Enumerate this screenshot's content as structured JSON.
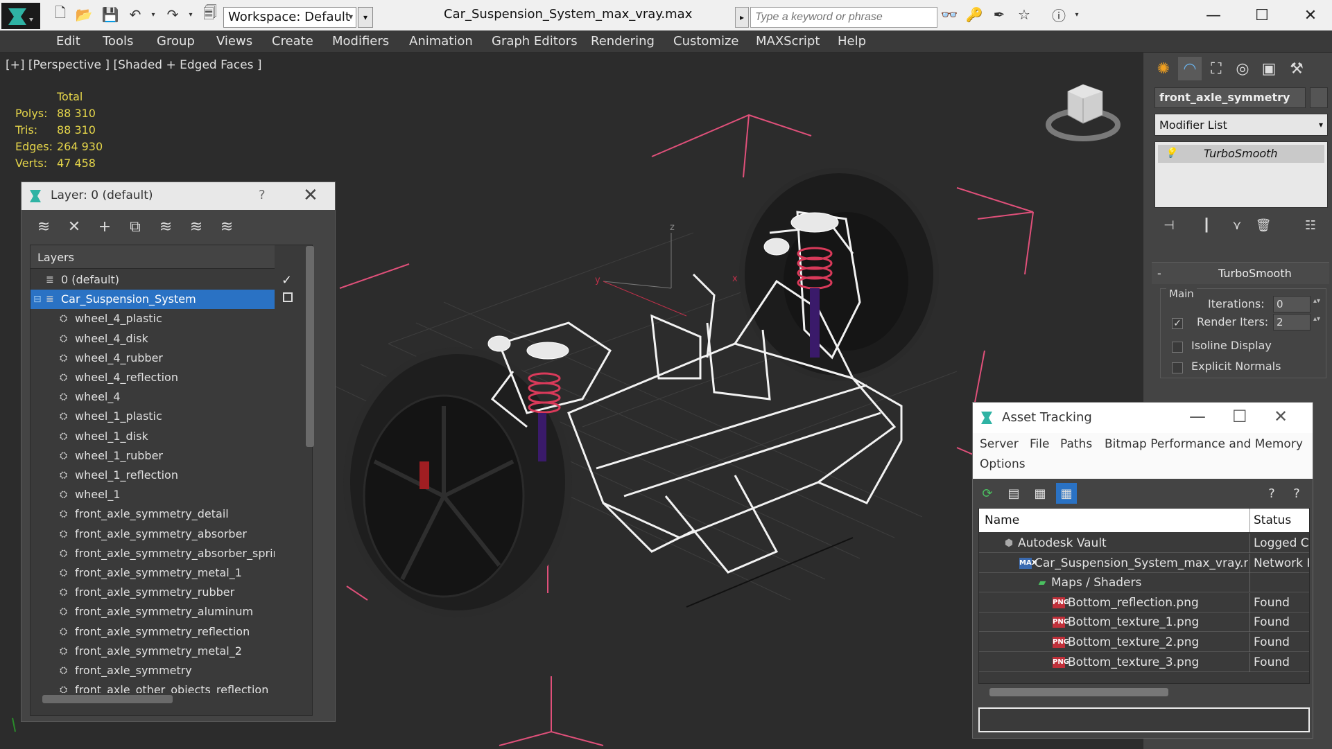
{
  "titlebar": {
    "workspace_value": "Workspace: Default",
    "document_title": "Car_Suspension_System_max_vray.max",
    "search_placeholder": "Type a keyword or phrase"
  },
  "menubar": {
    "items": [
      "Edit",
      "Tools",
      "Group",
      "Views",
      "Create",
      "Modifiers",
      "Animation",
      "Graph Editors",
      "Rendering",
      "Customize",
      "MAXScript",
      "Help"
    ]
  },
  "viewport": {
    "label": "[+] [Perspective ] [Shaded + Edged Faces ]",
    "stats": {
      "header": "Total",
      "rows": [
        {
          "key": "Polys:",
          "value": "88 310"
        },
        {
          "key": "Tris:",
          "value": "88 310"
        },
        {
          "key": "Edges:",
          "value": "264 930"
        },
        {
          "key": "Verts:",
          "value": "47 458"
        }
      ]
    },
    "axis_labels": {
      "z": "z",
      "y": "y",
      "x": "x"
    }
  },
  "layer_window": {
    "title": "Layer: 0 (default)",
    "help": "?",
    "column_header": "Layers",
    "items": [
      {
        "label": "0 (default)",
        "indent": 0,
        "type": "layer"
      },
      {
        "label": "Car_Suspension_System",
        "indent": 0,
        "type": "layer",
        "selected": true
      },
      {
        "label": "wheel_4_plastic",
        "indent": 1,
        "type": "object"
      },
      {
        "label": "wheel_4_disk",
        "indent": 1,
        "type": "object"
      },
      {
        "label": "wheel_4_rubber",
        "indent": 1,
        "type": "object"
      },
      {
        "label": "wheel_4_reflection",
        "indent": 1,
        "type": "object"
      },
      {
        "label": "wheel_4",
        "indent": 1,
        "type": "object"
      },
      {
        "label": "wheel_1_plastic",
        "indent": 1,
        "type": "object"
      },
      {
        "label": "wheel_1_disk",
        "indent": 1,
        "type": "object"
      },
      {
        "label": "wheel_1_rubber",
        "indent": 1,
        "type": "object"
      },
      {
        "label": "wheel_1_reflection",
        "indent": 1,
        "type": "object"
      },
      {
        "label": "wheel_1",
        "indent": 1,
        "type": "object"
      },
      {
        "label": "front_axle_symmetry_detail",
        "indent": 1,
        "type": "object"
      },
      {
        "label": "front_axle_symmetry_absorber",
        "indent": 1,
        "type": "object"
      },
      {
        "label": "front_axle_symmetry_absorber_spring",
        "indent": 1,
        "type": "object"
      },
      {
        "label": "front_axle_symmetry_metal_1",
        "indent": 1,
        "type": "object"
      },
      {
        "label": "front_axle_symmetry_rubber",
        "indent": 1,
        "type": "object"
      },
      {
        "label": "front_axle_symmetry_aluminum",
        "indent": 1,
        "type": "object"
      },
      {
        "label": "front_axle_symmetry_reflection",
        "indent": 1,
        "type": "object"
      },
      {
        "label": "front_axle_symmetry_metal_2",
        "indent": 1,
        "type": "object"
      },
      {
        "label": "front_axle_symmetry",
        "indent": 1,
        "type": "object"
      },
      {
        "label": "front_axle_other_objects_reflection",
        "indent": 1,
        "type": "object"
      }
    ]
  },
  "command_panel": {
    "object_name": "front_axle_symmetry",
    "modifier_list": "Modifier List",
    "stack_item": "TurboSmooth",
    "rollout_minus": "-",
    "rollout_title": "TurboSmooth",
    "group_main": "Main",
    "iterations_label": "Iterations:",
    "iterations_value": "0",
    "render_iters_label": "Render Iters:",
    "render_iters_value": "2",
    "isoline_label": "Isoline Display",
    "explicit_normals_label": "Explicit Normals"
  },
  "asset_tracking": {
    "title": "Asset Tracking",
    "menu": [
      "Server",
      "File",
      "Paths",
      "Bitmap Performance and Memory",
      "Options"
    ],
    "col_name": "Name",
    "col_status": "Status",
    "rows": [
      {
        "name": "Autodesk Vault",
        "status": "Logged C",
        "indent": 1,
        "icon": "vault"
      },
      {
        "name": "Car_Suspension_System_max_vray.max",
        "status": "Network I",
        "indent": 2,
        "icon": "max"
      },
      {
        "name": "Maps / Shaders",
        "status": "",
        "indent": 3,
        "icon": "maps"
      },
      {
        "name": "Bottom_reflection.png",
        "status": "Found",
        "indent": 4,
        "icon": "png"
      },
      {
        "name": "Bottom_texture_1.png",
        "status": "Found",
        "indent": 4,
        "icon": "png"
      },
      {
        "name": "Bottom_texture_2.png",
        "status": "Found",
        "indent": 4,
        "icon": "png"
      },
      {
        "name": "Bottom_texture_3.png",
        "status": "Found",
        "indent": 4,
        "icon": "png"
      }
    ]
  },
  "colors": {
    "selection": "#2a72c4",
    "stats_yellow": "#e6d64a",
    "bbox_pink": "#e0507a"
  }
}
